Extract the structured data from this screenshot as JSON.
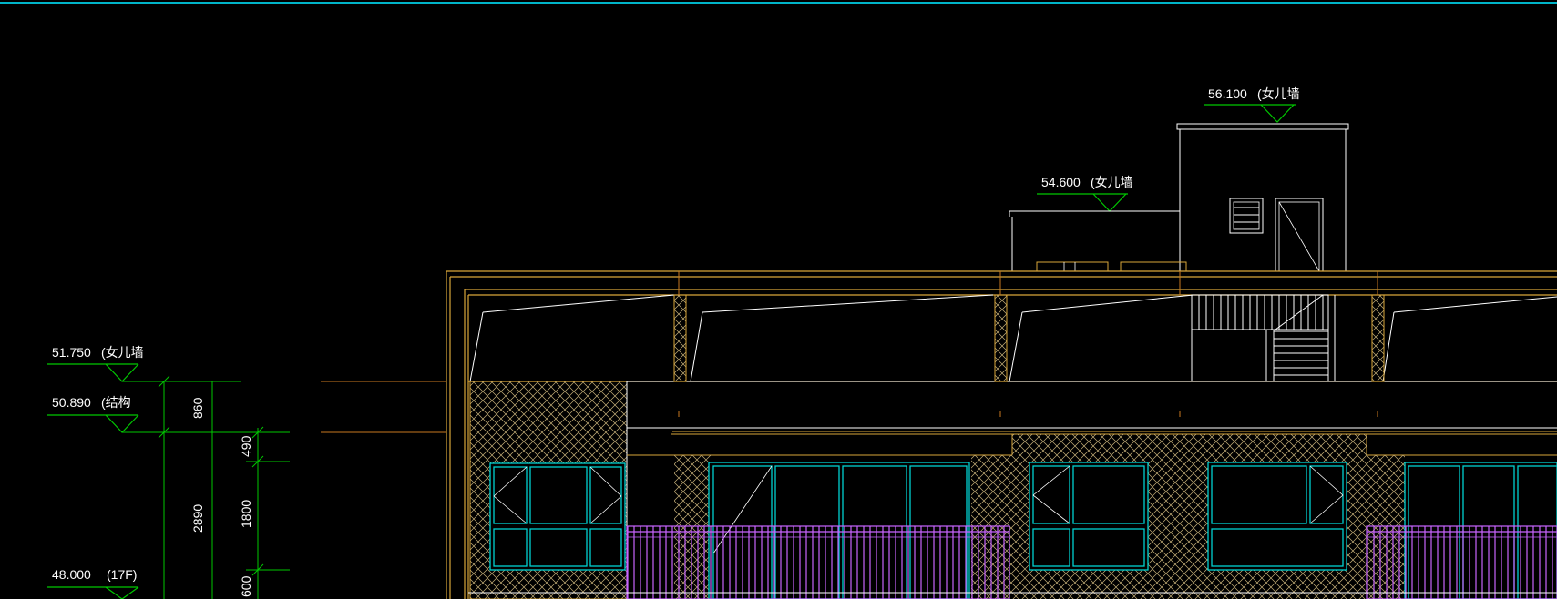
{
  "app": {
    "background": "#000000",
    "frame_color": "#00b4c8"
  },
  "colors": {
    "wall": "#ffffff",
    "outline": "#d9a63a",
    "hatch": "#c8b27a",
    "dim": "#00c800",
    "window": "#00d2d2",
    "railing": "#c864ff",
    "axis": "#c87820"
  },
  "elevations": [
    {
      "value": "56.100",
      "note": "(女儿墙"
    },
    {
      "value": "54.600",
      "note": "(女儿墙"
    },
    {
      "value": "51.750",
      "note": "(女儿墙"
    },
    {
      "value": "50.890",
      "note": "(结构"
    },
    {
      "value": "48.000",
      "note": "(17F)"
    }
  ],
  "dimensions": {
    "outer": [
      "860",
      "2890"
    ],
    "inner": [
      "490",
      "1800",
      "600"
    ]
  }
}
